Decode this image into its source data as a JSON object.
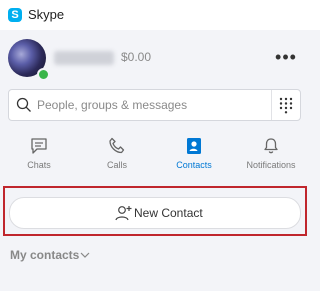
{
  "app": {
    "title": "Skype",
    "logo_letter": "S"
  },
  "profile": {
    "balance": "$0.00",
    "more_glyph": "•••",
    "presence": "online"
  },
  "search": {
    "placeholder": "People, groups & messages"
  },
  "tabs": [
    {
      "label": "Chats",
      "icon": "chat-icon",
      "active": false
    },
    {
      "label": "Calls",
      "icon": "phone-icon",
      "active": false
    },
    {
      "label": "Contacts",
      "icon": "contacts-icon",
      "active": true
    },
    {
      "label": "Notifications",
      "icon": "bell-icon",
      "active": false
    }
  ],
  "new_contact": {
    "label": "New Contact"
  },
  "my_contacts": {
    "label": "My contacts"
  },
  "colors": {
    "accent": "#0078d4",
    "highlight": "#c0262d",
    "presence": "#3ab54a"
  }
}
